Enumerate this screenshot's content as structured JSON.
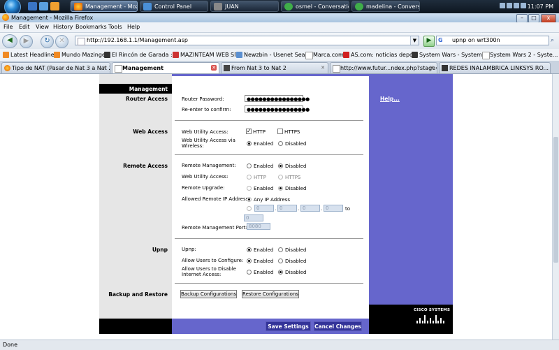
{
  "taskbar": {
    "buttons": [
      {
        "label": "Management - Moz...",
        "active": true
      },
      {
        "label": "Control Panel",
        "active": false
      },
      {
        "label": "JUAN",
        "active": false
      },
      {
        "label": "osmel - Conversation",
        "active": false
      },
      {
        "label": "madelina - Convers...",
        "active": false
      }
    ],
    "clock": "11:07 PM"
  },
  "window": {
    "title": "Management - Mozilla Firefox",
    "controls": {
      "minimize": "–",
      "maximize": "□",
      "close": "x"
    }
  },
  "menu": [
    "File",
    "Edit",
    "View",
    "History",
    "Bookmarks",
    "Tools",
    "Help"
  ],
  "navbar": {
    "url": "http://192.168.1.1/Management.asp",
    "search_engine_glyph": "G",
    "search_value": "upnp on wrt300n",
    "icons": [
      "back-icon",
      "forward-icon",
      "reload-icon",
      "stop-icon",
      "home-icon",
      "go-icon",
      "search-go-icon"
    ]
  },
  "bookmarks": [
    "Latest Headlines",
    "Mundo Mazinger",
    "El Rincón de Garada ::...",
    "MAZINTEAM WEB SITE",
    "Newzbin - Usenet Sear...",
    "Marca.com",
    "AS.com: noticias depo...",
    "System Wars - System...",
    "System Wars 2 - Syste..."
  ],
  "tabs": [
    {
      "label": "Tipo de NAT (Pasar de Nat 3 a Nat 2)",
      "active": false
    },
    {
      "label": "Management",
      "active": true
    },
    {
      "label": "From Nat 3 to Nat 2",
      "active": false
    },
    {
      "label": "http://www.futur...ndex.php?stage=1",
      "active": false
    },
    {
      "label": "REDES INALAMBRICA LINKSYS RO...",
      "active": false
    }
  ],
  "page": {
    "header_label": "Management",
    "help_link": "Help...",
    "sections": {
      "router_access": {
        "label": "Router Access",
        "password_label": "Router Password:",
        "password_value": "●●●●●●●●●●●●●●●●",
        "reenter_label": "Re-enter to  confirm:",
        "reenter_value": "●●●●●●●●●●●●●●●●"
      },
      "web_access": {
        "label": "Web Access",
        "utility_label": "Web Utility Access:",
        "http_label": "HTTP",
        "http_checked": true,
        "https_label": "HTTPS",
        "https_checked": false,
        "wireless_label": "Web Utility Access via Wireless:",
        "enabled_label": "Enabled",
        "disabled_label": "Disabled",
        "wireless_value": "Enabled"
      },
      "remote_access": {
        "label": "Remote Access",
        "management_label": "Remote  Management:",
        "management_value": "Disabled",
        "utility_label": "Web Utility Access:",
        "http_label": "HTTP",
        "https_label": "HTTPS",
        "upgrade_label": "Remote Upgrade:",
        "upgrade_value": "Disabled",
        "allowed_label": "Allowed Remote IP Address:",
        "any_ip_label": "Any IP Address",
        "ip_start": [
          "0",
          "0",
          "0",
          "0"
        ],
        "to_label": "to",
        "ip_end": "0",
        "port_label": "Remote Management Port:",
        "port_value": "8080",
        "enabled_label": "Enabled",
        "disabled_label": "Disabled"
      },
      "upnp": {
        "label": "Upnp",
        "upnp_label": "Upnp:",
        "upnp_value": "Enabled",
        "configure_label": "Allow Users to Configure:",
        "configure_value": "Enabled",
        "disable_label": "Allow Users to Disable Internet Access:",
        "disable_value": "Disabled",
        "enabled_label": "Enabled",
        "disabled_label": "Disabled"
      },
      "backup": {
        "label": "Backup and Restore",
        "backup_button": "Backup Configurations",
        "restore_button": "Restore Configurations"
      }
    },
    "footer": {
      "save_button": "Save Settings",
      "cancel_button": "Cancel Changes"
    },
    "logo_text": "CISCO SYSTEMS"
  },
  "status": "Done",
  "colors": {
    "router_purple": "#6666cc",
    "router_blue_button": "#333399",
    "left_column_grey": "#e6e6e6"
  }
}
